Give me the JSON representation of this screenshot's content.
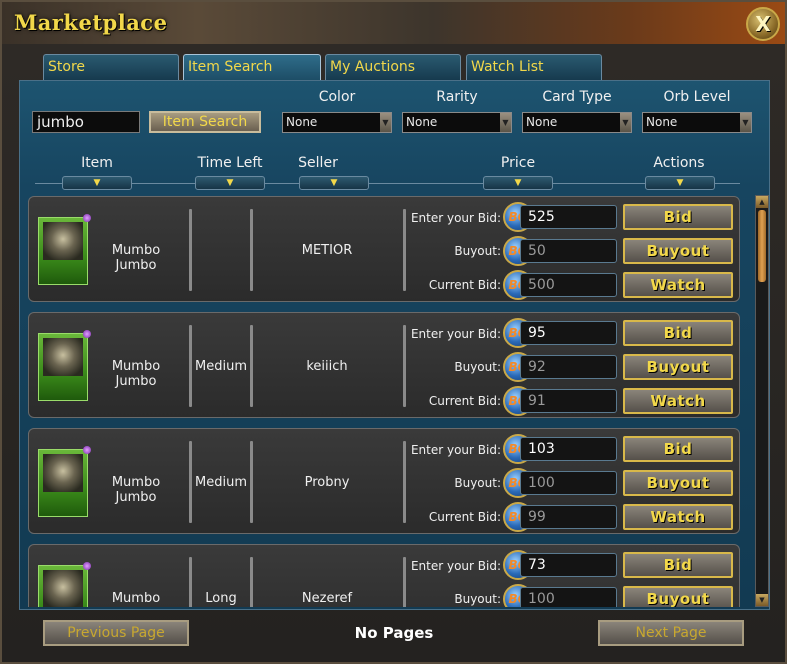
{
  "window": {
    "title": "Marketplace",
    "close_label": "X"
  },
  "tabs": [
    {
      "label": "Store",
      "active": false
    },
    {
      "label": "Item Search",
      "active": true
    },
    {
      "label": "My Auctions",
      "active": false
    },
    {
      "label": "Watch List",
      "active": false
    }
  ],
  "search": {
    "value": "jumbo",
    "button_label": "Item Search"
  },
  "filters": [
    {
      "label": "Color",
      "value": "None"
    },
    {
      "label": "Rarity",
      "value": "None"
    },
    {
      "label": "Card Type",
      "value": "None"
    },
    {
      "label": "Orb Level",
      "value": "None"
    }
  ],
  "columns": [
    "Item",
    "Time Left",
    "Seller",
    "Price",
    "Actions"
  ],
  "bid_labels": {
    "enter": "Enter your Bid:",
    "buyout": "Buyout:",
    "current": "Current Bid:"
  },
  "coin_label": "BG",
  "action_labels": {
    "bid": "Bid",
    "buyout": "Buyout",
    "watch": "Watch"
  },
  "listings": [
    {
      "item": "Mumbo Jumbo",
      "time_left": "",
      "seller": "METIOR",
      "bid": "525",
      "buyout": "50",
      "current_bid": "500"
    },
    {
      "item": "Mumbo Jumbo",
      "time_left": "Medium",
      "seller": "keiiich",
      "bid": "95",
      "buyout": "92",
      "current_bid": "91"
    },
    {
      "item": "Mumbo Jumbo",
      "time_left": "Medium",
      "seller": "Probny",
      "bid": "103",
      "buyout": "100",
      "current_bid": "99"
    },
    {
      "item": "Mumbo Jumbo",
      "time_left": "Long",
      "seller": "Nezeref",
      "bid": "73",
      "buyout": "100",
      "current_bid": ""
    }
  ],
  "pagination": {
    "prev_label": "Previous Page",
    "status": "No Pages",
    "next_label": "Next Page"
  },
  "colors": {
    "title": "#f2d84a",
    "tab_text": "#f2d84a",
    "panel": "#174560",
    "button_border": "#d8b84a"
  }
}
